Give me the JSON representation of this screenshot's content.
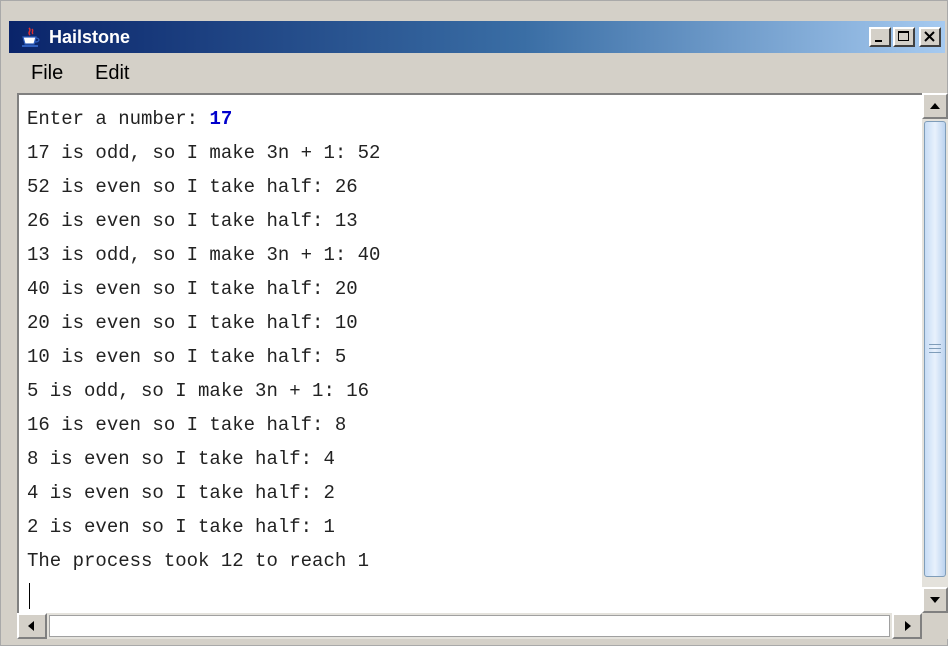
{
  "window": {
    "title": "Hailstone",
    "app_icon": "java-cup-icon",
    "controls": [
      "minimize-icon",
      "maximize-icon",
      "close-icon"
    ]
  },
  "menu": {
    "items": [
      "File",
      "Edit"
    ]
  },
  "console": {
    "prompt": "Enter a number: ",
    "input_value": "17",
    "input_color": "#0000cc",
    "lines": [
      "17 is odd, so I make 3n + 1: 52",
      "52 is even so I take half: 26",
      "26 is even so I take half: 13",
      "13 is odd, so I make 3n + 1: 40",
      "40 is even so I take half: 20",
      "20 is even so I take half: 10",
      "10 is even so I take half: 5",
      "5 is odd, so I make 3n + 1: 16",
      "16 is even so I take half: 8",
      "8 is even so I take half: 4",
      "4 is even so I take half: 2",
      "2 is even so I take half: 1",
      "The process took 12 to reach 1"
    ]
  },
  "colors": {
    "titlebar_start": "#0a246a",
    "titlebar_end": "#a6caf0",
    "window_bg": "#d4d0c8"
  }
}
